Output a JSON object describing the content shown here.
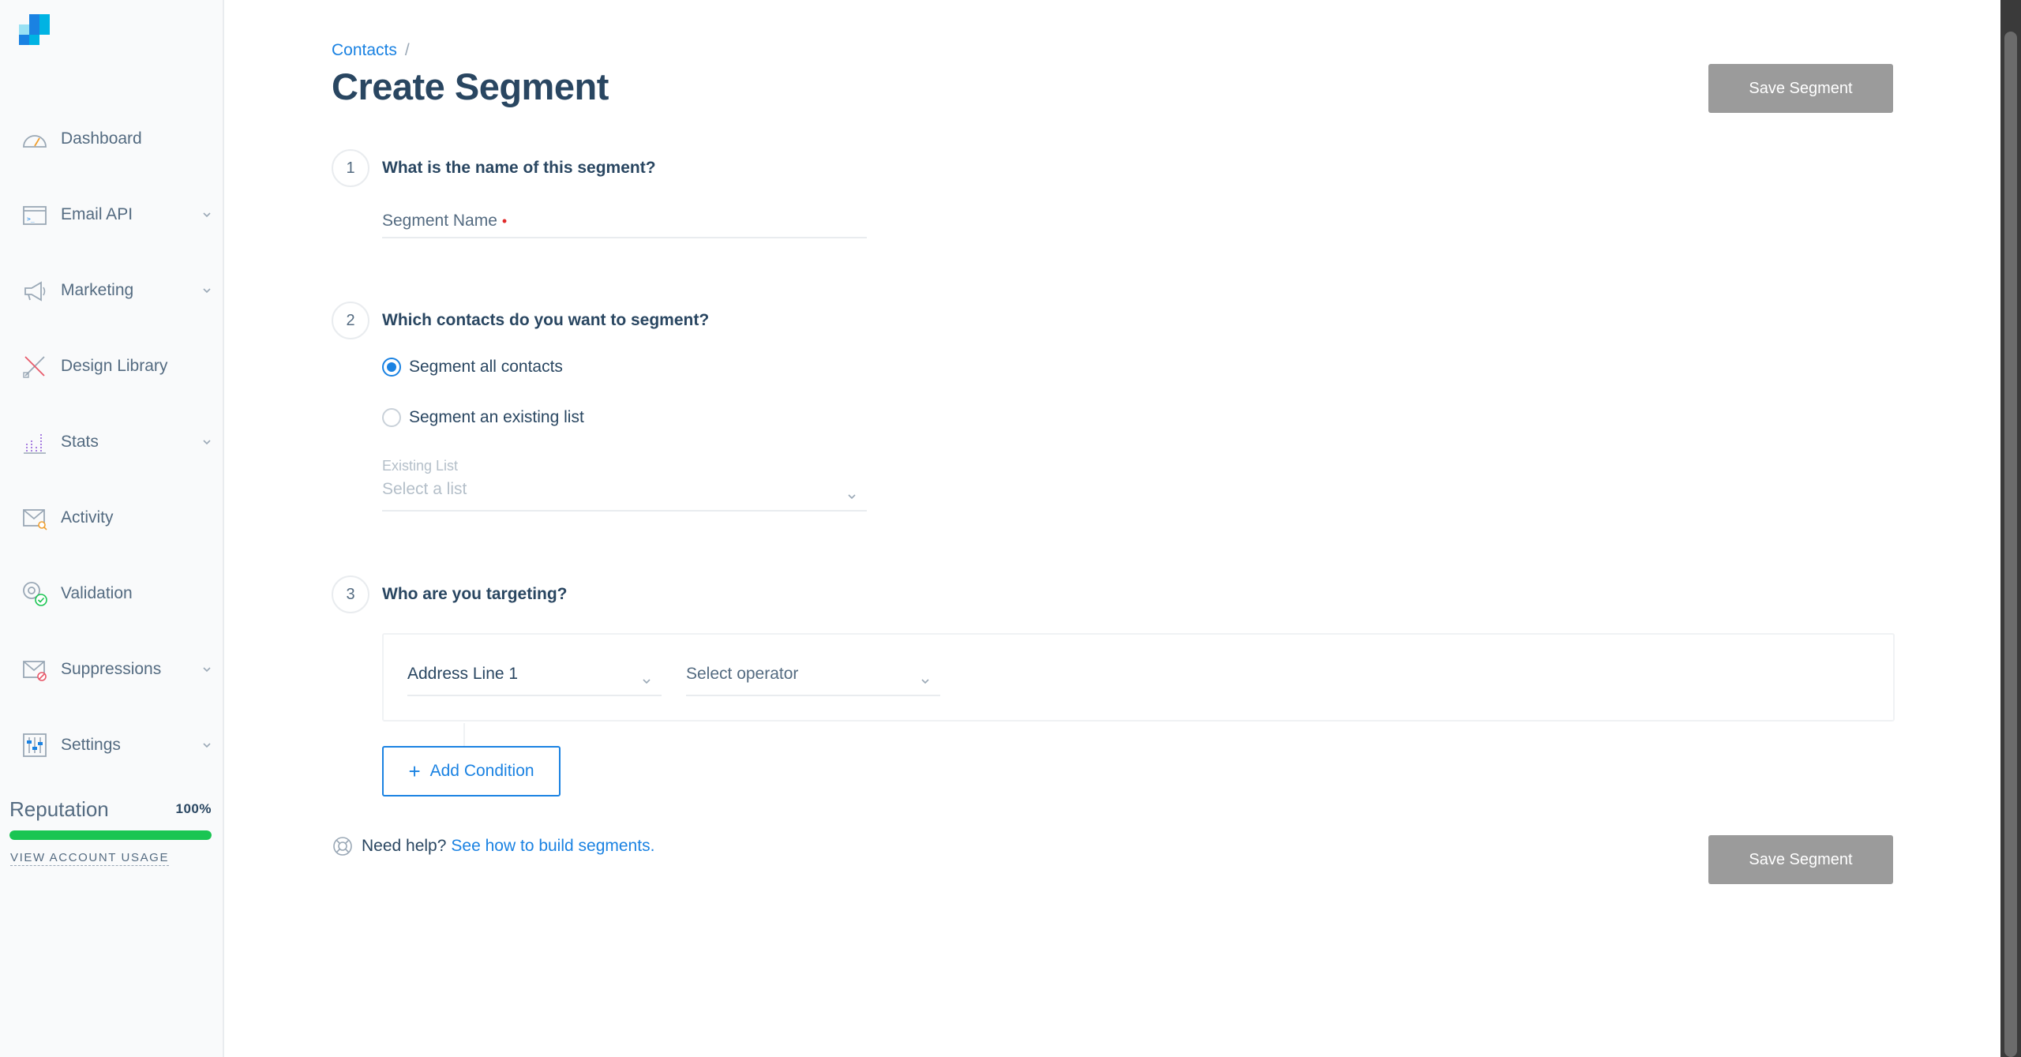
{
  "sidebar": {
    "items": [
      {
        "label": "Dashboard",
        "icon": "dashboard-icon",
        "has_chevron": false
      },
      {
        "label": "Email API",
        "icon": "email-api-icon",
        "has_chevron": true
      },
      {
        "label": "Marketing",
        "icon": "megaphone-icon",
        "has_chevron": true
      },
      {
        "label": "Design Library",
        "icon": "design-library-icon",
        "has_chevron": false
      },
      {
        "label": "Stats",
        "icon": "stats-icon",
        "has_chevron": true
      },
      {
        "label": "Activity",
        "icon": "activity-icon",
        "has_chevron": false
      },
      {
        "label": "Validation",
        "icon": "validation-icon",
        "has_chevron": false
      },
      {
        "label": "Suppressions",
        "icon": "suppressions-icon",
        "has_chevron": true
      },
      {
        "label": "Settings",
        "icon": "settings-icon",
        "has_chevron": true
      }
    ],
    "reputation": {
      "label": "Reputation",
      "value": "100%",
      "fraction": 1.0
    },
    "account_usage_label": "VIEW ACCOUNT USAGE"
  },
  "header": {
    "breadcrumb": "Contacts",
    "breadcrumb_sep": "/",
    "title": "Create Segment",
    "save_label": "Save Segment"
  },
  "steps": [
    {
      "number": "1",
      "title": "What is the name of this segment?"
    },
    {
      "number": "2",
      "title": "Which contacts do you want to segment?"
    },
    {
      "number": "3",
      "title": "Who are you targeting?"
    }
  ],
  "segment_name": {
    "label": "Segment Name",
    "required_mark": "•"
  },
  "contacts_options": [
    {
      "label": "Segment all contacts",
      "checked": true
    },
    {
      "label": "Segment an existing list",
      "checked": false
    }
  ],
  "existing_list": {
    "label": "Existing List",
    "placeholder": "Select a list"
  },
  "condition": {
    "field_value": "Address Line 1",
    "operator_placeholder": "Select operator"
  },
  "add_condition_label": "Add Condition",
  "help": {
    "prefix": "Need help?",
    "link": "See how to build segments."
  },
  "colors": {
    "accent": "#1a82e2",
    "disabled_button": "#9b9b9b",
    "reputation_bar": "#1ac552",
    "title": "#294661"
  }
}
